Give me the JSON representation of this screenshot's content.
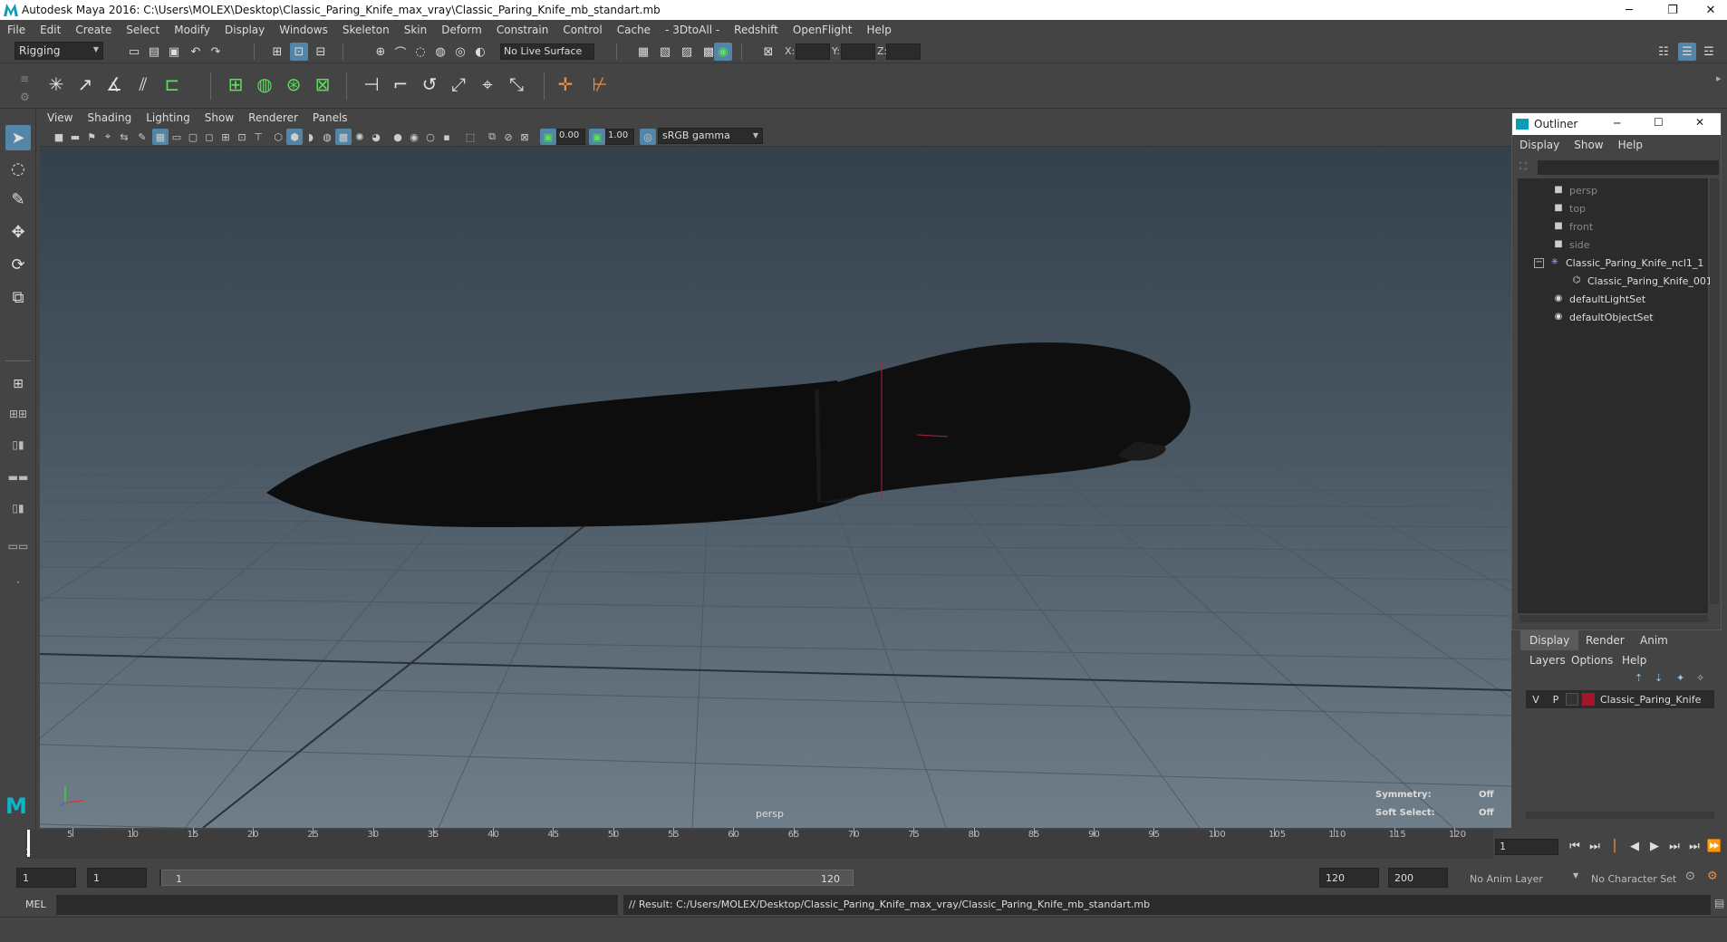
{
  "window": {
    "title": "Autodesk Maya 2016: C:\\Users\\MOLEX\\Desktop\\Classic_Paring_Knife_max_vray\\Classic_Paring_Knife_mb_standart.mb",
    "minimize": "─",
    "restore": "❐",
    "close": "✕"
  },
  "menubar": [
    "File",
    "Edit",
    "Create",
    "Select",
    "Modify",
    "Display",
    "Windows",
    "Skeleton",
    "Skin",
    "Deform",
    "Constrain",
    "Control",
    "Cache",
    "- 3DtoAll -",
    "Redshift",
    "OpenFlight",
    "Help"
  ],
  "statusline": {
    "menuset": "Rigging",
    "live_surface": "No Live Surface",
    "x_label": "X:",
    "y_label": "Y:",
    "z_label": "Z:"
  },
  "viewport": {
    "menu": [
      "View",
      "Shading",
      "Lighting",
      "Show",
      "Renderer",
      "Panels"
    ],
    "exposure": "0.00",
    "gamma": "1.00",
    "colorspace": "sRGB gamma",
    "camera_label": "persp",
    "symmetry_label": "Symmetry:",
    "symmetry_value": "Off",
    "soft_select_label": "Soft Select:",
    "soft_select_value": "Off"
  },
  "outliner": {
    "title": "Outliner",
    "menu": [
      "Display",
      "Show",
      "Help"
    ],
    "items": [
      {
        "label": "persp",
        "icon": "camera-icon"
      },
      {
        "label": "top",
        "icon": "camera-icon"
      },
      {
        "label": "front",
        "icon": "camera-icon"
      },
      {
        "label": "side",
        "icon": "camera-icon"
      },
      {
        "label": "Classic_Paring_Knife_ncl1_1",
        "icon": "locator-icon"
      },
      {
        "label": "Classic_Paring_Knife_001",
        "icon": "mesh-icon"
      },
      {
        "label": "defaultLightSet",
        "icon": "set-icon"
      },
      {
        "label": "defaultObjectSet",
        "icon": "set-icon"
      }
    ]
  },
  "layer_editor": {
    "tabs": [
      "Display",
      "Render",
      "Anim"
    ],
    "menu": [
      "Layers",
      "Options",
      "Help"
    ],
    "layer": {
      "v": "V",
      "p": "P",
      "name": "Classic_Paring_Knife",
      "color": "#a3172d"
    }
  },
  "timeline": {
    "ticks": [
      "5",
      "10",
      "15",
      "20",
      "25",
      "30",
      "35",
      "40",
      "45",
      "50",
      "55",
      "60",
      "65",
      "70",
      "75",
      "80",
      "85",
      "90",
      "95",
      "100",
      "105",
      "110",
      "115",
      "120"
    ],
    "start_label": "1",
    "current_frame": "1"
  },
  "range": {
    "start": "1",
    "playback_start": "1",
    "slider_start": "1",
    "slider_end": "120",
    "playback_end": "120",
    "end": "200",
    "anim_layer": "No Anim Layer",
    "character_set": "No Character Set"
  },
  "command": {
    "label": "MEL",
    "result": "// Result: C:/Users/MOLEX/Desktop/Classic_Paring_Knife_max_vray/Classic_Paring_Knife_mb_standart.mb"
  },
  "colors": {
    "accent": "#5285a6",
    "layer": "#a3172d",
    "shelf_green": "#5ce05c"
  }
}
